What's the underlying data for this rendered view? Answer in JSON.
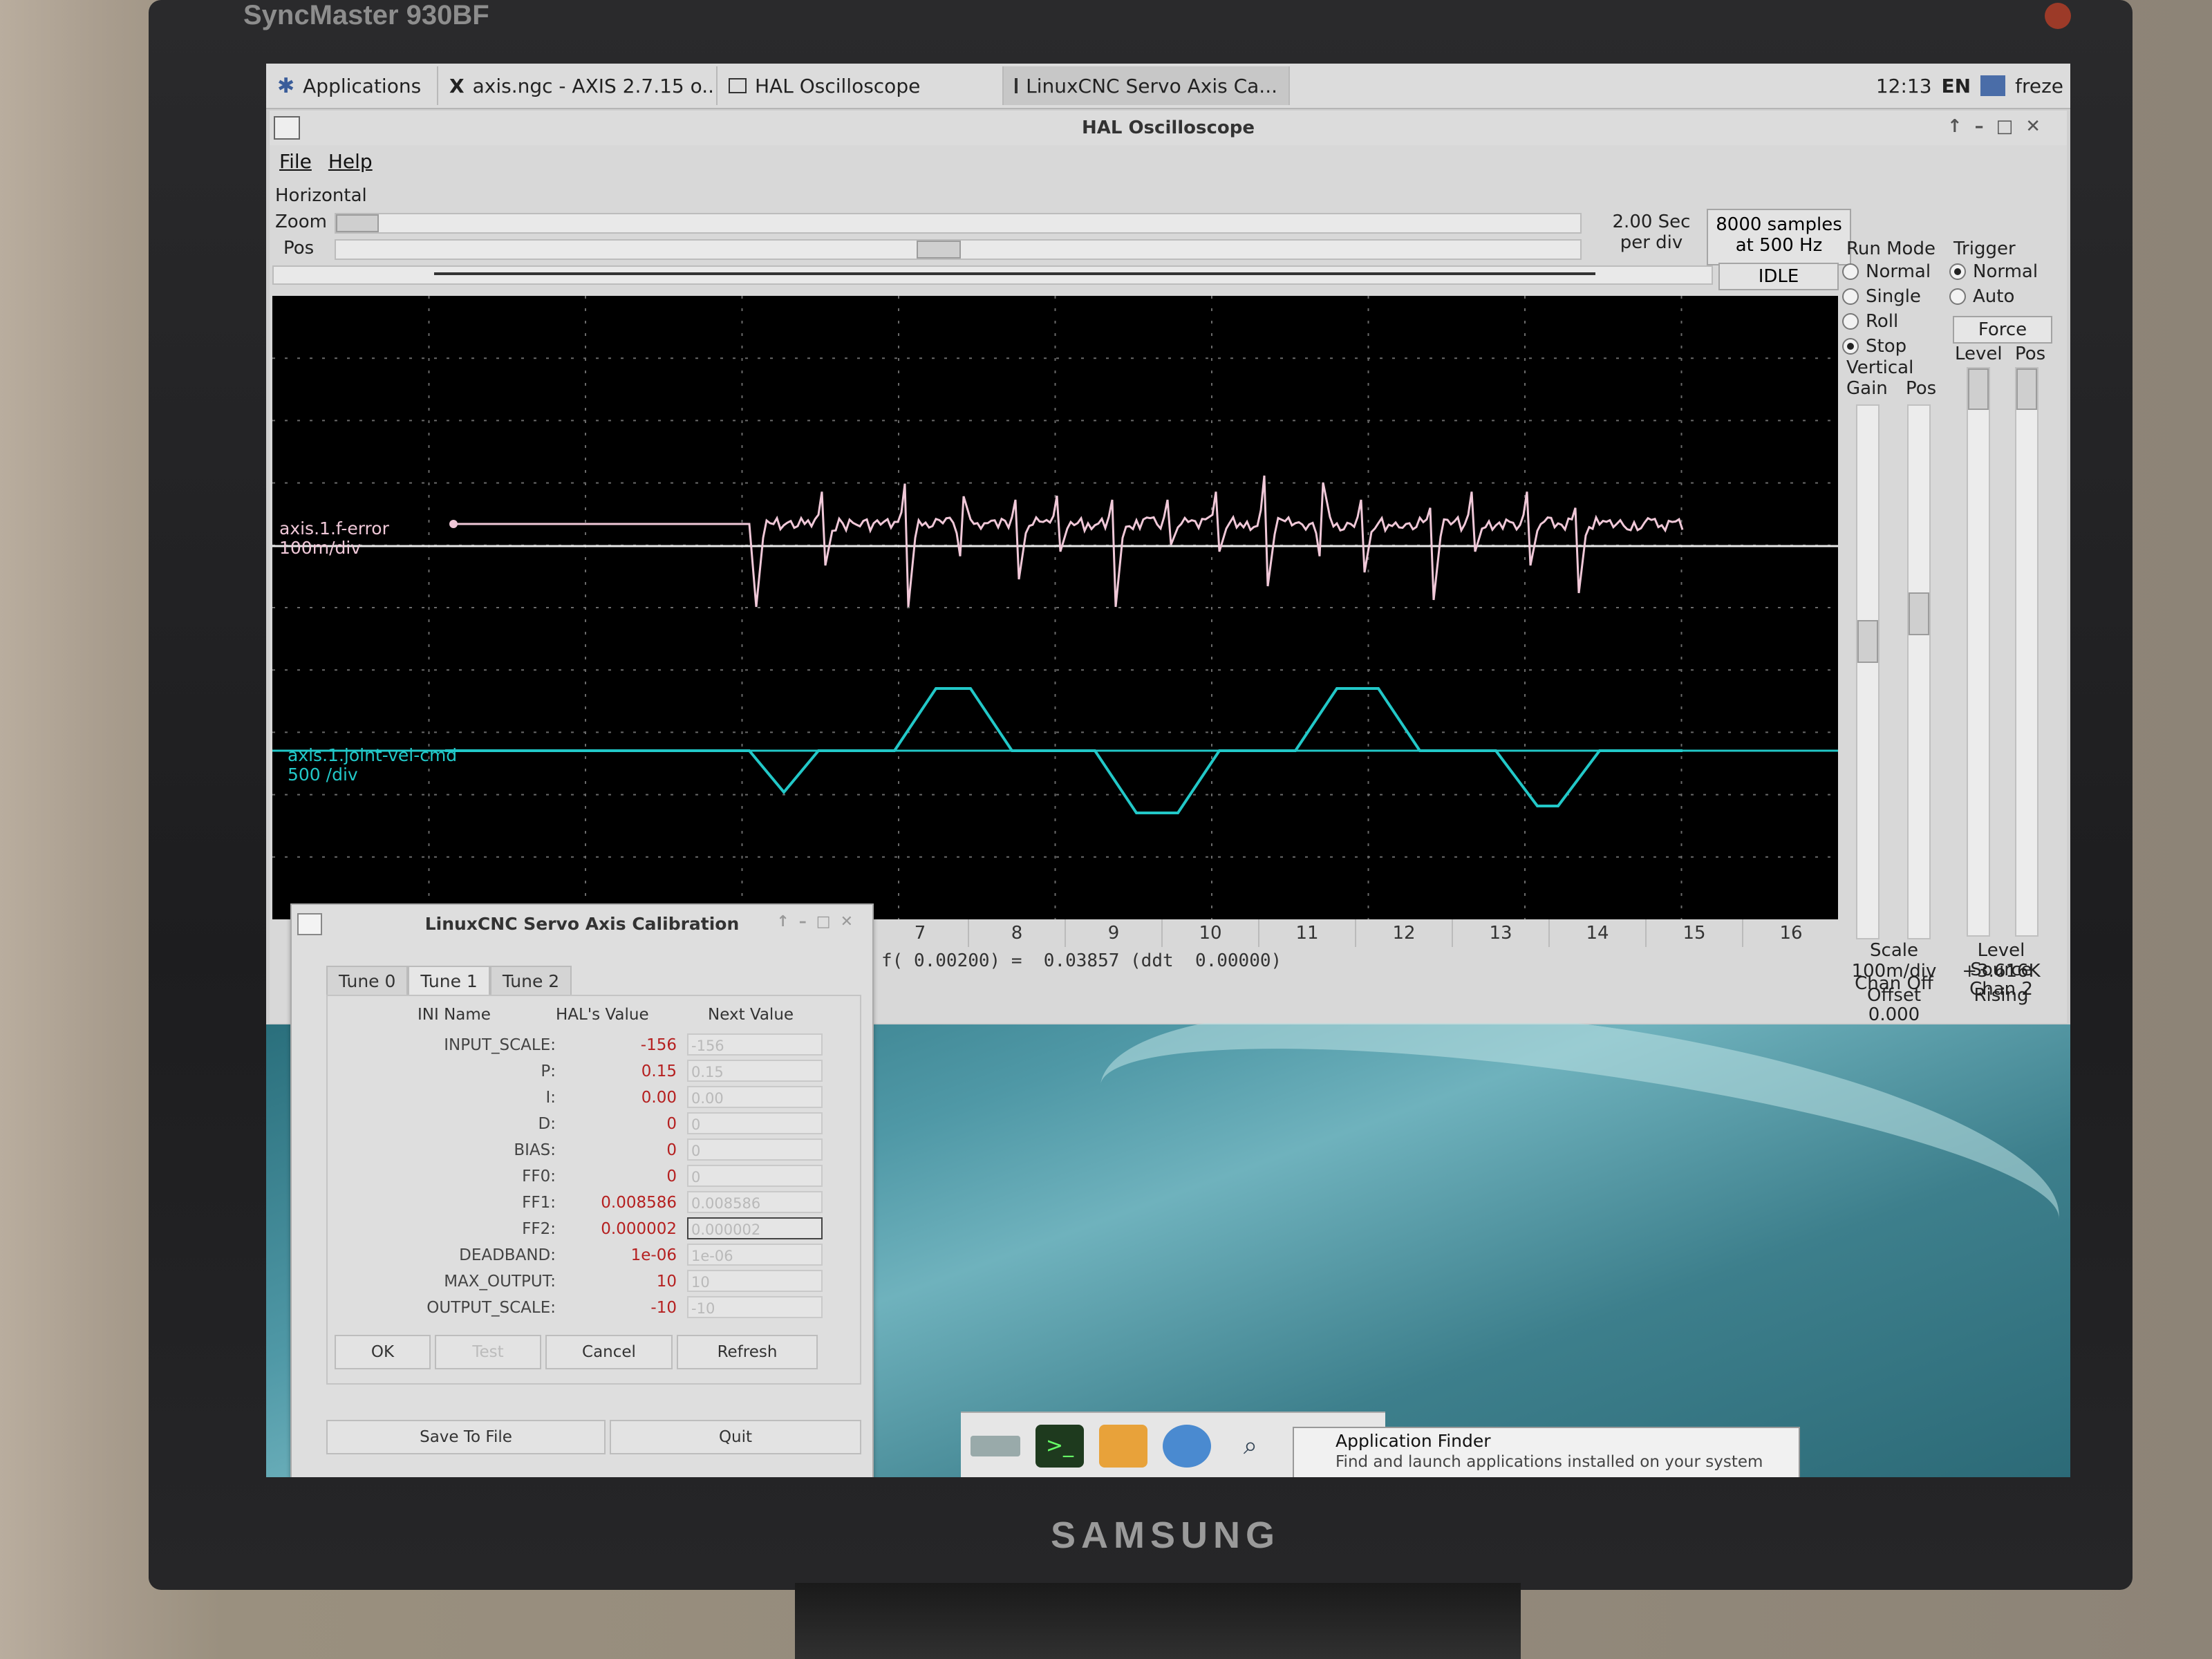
{
  "monitor": {
    "brand_top": "SyncMaster 930BF",
    "brand_bottom": "SAMSUNG"
  },
  "panel": {
    "applications": "Applications",
    "tasks": [
      "axis.ngc - AXIS 2.7.15 o...",
      "HAL Oscilloscope",
      "LinuxCNC Servo Axis Ca..."
    ],
    "clock": "12:13",
    "lang": "EN",
    "user": "freze"
  },
  "scope": {
    "title": "HAL Oscilloscope",
    "menu": [
      "File",
      "Help"
    ],
    "horizontal": {
      "label": "Horizontal",
      "zoom": "Zoom",
      "pos": "Pos",
      "time_per_div": "2.00 Sec",
      "per_div": "per div",
      "samples": "8000 samples",
      "rate": "at 500 Hz",
      "state": "IDLE"
    },
    "run_mode": {
      "label": "Run Mode",
      "options": [
        "Normal",
        "Single",
        "Roll",
        "Stop"
      ],
      "selected": "Stop"
    },
    "trigger": {
      "label": "Trigger",
      "options": [
        "Normal",
        "Auto"
      ],
      "selected": "Normal",
      "force": "Force",
      "level": "Level",
      "pos": "Pos"
    },
    "vertical": {
      "label": "Vertical",
      "gain": "Gain",
      "pos": "Pos",
      "scale_label": "Scale",
      "scale": "100m/div",
      "offset_label": "Offset",
      "offset": "0.000",
      "chan_off": "Chan Off"
    },
    "trigger_info": {
      "level_label": "Level",
      "level": "+3.616K",
      "edge": "Rising",
      "source_label": "Source",
      "source": "Chan  2"
    },
    "x_ticks": [
      "7",
      "8",
      "9",
      "10",
      "11",
      "12",
      "13",
      "14",
      "15",
      "16"
    ],
    "readout": "f( 0.00200) =  0.03857 (ddt  0.00000)",
    "channels": [
      {
        "name": "axis.1.f-error",
        "scale": "100m/div",
        "color": "#f0c8d8"
      },
      {
        "name": "axis.1.joint-vel-cmd",
        "scale": "500 /div",
        "color": "#22c8c8"
      }
    ]
  },
  "calibration": {
    "title": "LinuxCNC Servo Axis Calibration",
    "tabs": [
      "Tune 0",
      "Tune 1",
      "Tune 2"
    ],
    "active_tab": "Tune 1",
    "headers": {
      "name": "INI Name",
      "hal": "HAL's Value",
      "next": "Next Value"
    },
    "rows": [
      {
        "name": "INPUT_SCALE:",
        "hal": "-156",
        "next": "-156"
      },
      {
        "name": "P:",
        "hal": "0.15",
        "next": "0.15"
      },
      {
        "name": "I:",
        "hal": "0.00",
        "next": "0.00"
      },
      {
        "name": "D:",
        "hal": "0",
        "next": "0"
      },
      {
        "name": "BIAS:",
        "hal": "0",
        "next": "0"
      },
      {
        "name": "FF0:",
        "hal": "0",
        "next": "0"
      },
      {
        "name": "FF1:",
        "hal": "0.008586",
        "next": "0.008586"
      },
      {
        "name": "FF2:",
        "hal": "0.000002",
        "next": "0.000002"
      },
      {
        "name": "DEADBAND:",
        "hal": "1e-06",
        "next": "1e-06"
      },
      {
        "name": "MAX_OUTPUT:",
        "hal": "10",
        "next": "10"
      },
      {
        "name": "OUTPUT_SCALE:",
        "hal": "-10",
        "next": "-10"
      }
    ],
    "buttons": {
      "ok": "OK",
      "test": "Test",
      "cancel": "Cancel",
      "refresh": "Refresh",
      "save": "Save To File",
      "quit": "Quit"
    }
  },
  "dock": {
    "icons": [
      "drive-icon",
      "terminal-icon",
      "folder-icon",
      "browser-icon",
      "search-icon",
      "app-finder-icon"
    ],
    "tooltip_title": "Application Finder",
    "tooltip_text": "Find and launch applications installed on your system"
  }
}
